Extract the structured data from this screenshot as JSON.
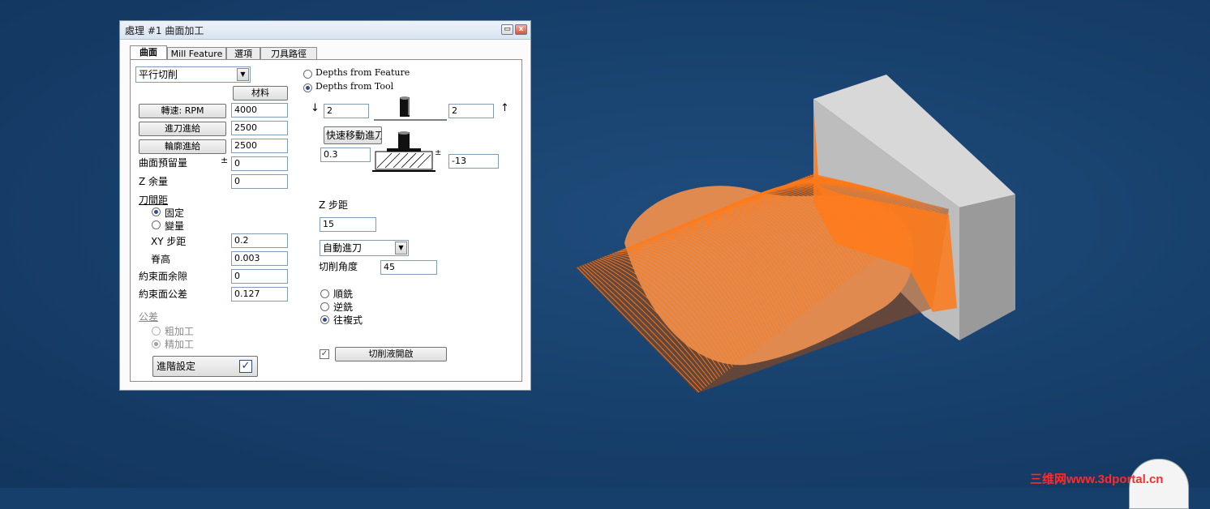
{
  "dialog": {
    "title": "處理 #1 曲面加工",
    "min_glyph": "▭",
    "close_glyph": "x",
    "tabs": [
      "曲面",
      "Mill Feature",
      "選項",
      "刀具路徑"
    ]
  },
  "left": {
    "strategy_value": "平行切削",
    "material_button": "材料",
    "rpm_button": "轉速: RPM",
    "rpm_value": "4000",
    "feed_button": "進刀進給",
    "feed_value": "2500",
    "contour_button": "輪廓進給",
    "contour_value": "2500",
    "surface_allowance_label": "曲面預留量",
    "plusminus": "±",
    "surface_allowance_value": "0",
    "z_allowance_label": "Z 余量",
    "z_allowance_value": "0",
    "stepover_section": "刀間距",
    "fixed_label": "固定",
    "variable_label": "變量",
    "xy_step_label": "XY 步距",
    "xy_step_value": "0.2",
    "scallop_label": "脊高",
    "scallop_value": "0.003",
    "constraint_allowance_label": "約束面余隙",
    "constraint_allowance_value": "0",
    "constraint_tolerance_label": "約束面公差",
    "constraint_tolerance_value": "0.127",
    "tolerance_section": "公差",
    "rough_label": "粗加工",
    "finish_label": "精加工",
    "advanced_button": "進階設定"
  },
  "right": {
    "depth_feature_label": "Depths from Feature",
    "depth_tool_label": "Depths from Tool",
    "top_left_value": "2",
    "top_right_value": "2",
    "rapid_button": "快速移動進刀",
    "bottom_left_value": "0.3",
    "bottom_right_value": "-13",
    "z_step_label": "Z 步距",
    "z_step_value": "15",
    "entry_mode_value": "自動進刀",
    "cut_angle_label": "切削角度",
    "cut_angle_value": "45",
    "climb_label": "順銑",
    "conventional_label": "逆銑",
    "zigzag_label": "往複式",
    "coolant_button": "切削液開啟"
  },
  "watermark": "三维网www.3dportal.cn",
  "colors": {
    "background": "#173f6b",
    "toolpath": "#ff7a1a",
    "stock_gray": "#c8c8c8"
  }
}
